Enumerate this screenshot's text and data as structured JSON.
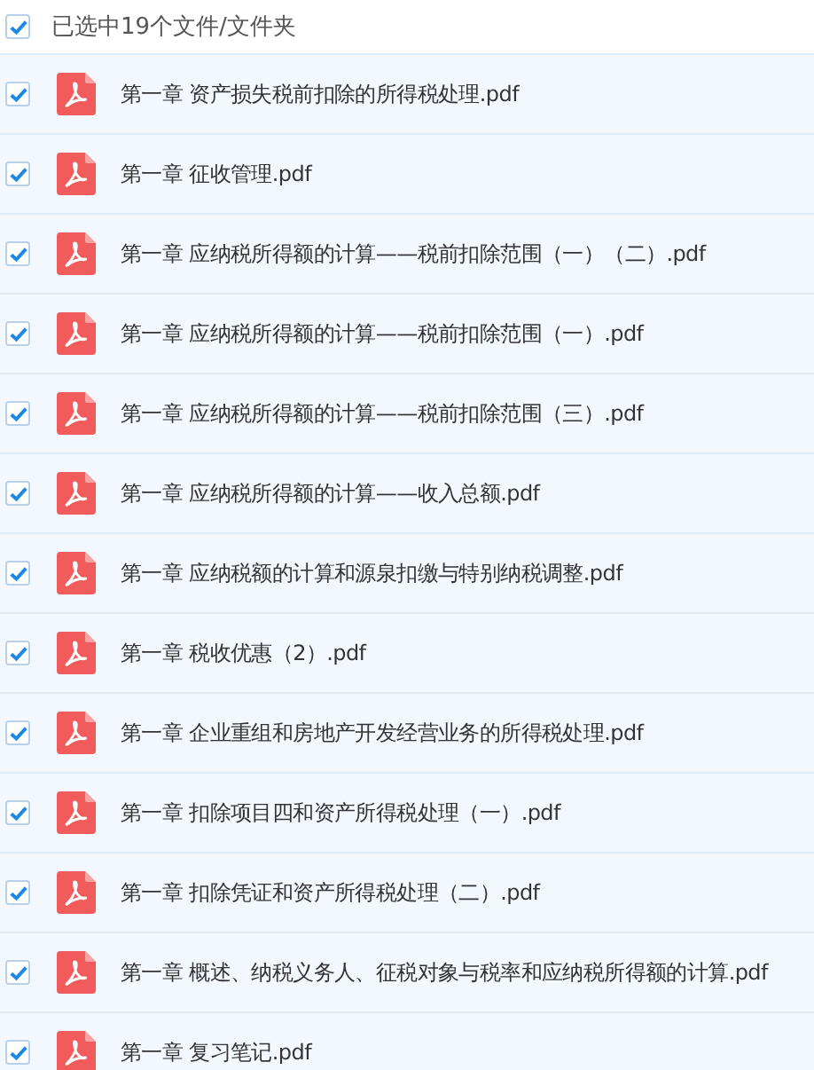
{
  "header": {
    "checked": true,
    "label": "已选中19个文件/文件夹"
  },
  "files": [
    {
      "checked": true,
      "name": "第一章 资产损失税前扣除的所得税处理.pdf"
    },
    {
      "checked": true,
      "name": "第一章 征收管理.pdf"
    },
    {
      "checked": true,
      "name": "第一章 应纳税所得额的计算——税前扣除范围（一）（二）.pdf"
    },
    {
      "checked": true,
      "name": "第一章 应纳税所得额的计算——税前扣除范围（一）.pdf"
    },
    {
      "checked": true,
      "name": "第一章 应纳税所得额的计算——税前扣除范围（三）.pdf"
    },
    {
      "checked": true,
      "name": "第一章 应纳税所得额的计算——收入总额.pdf"
    },
    {
      "checked": true,
      "name": "第一章 应纳税额的计算和源泉扣缴与特别纳税调整.pdf"
    },
    {
      "checked": true,
      "name": "第一章 税收优惠（2）.pdf"
    },
    {
      "checked": true,
      "name": "第一章 企业重组和房地产开发经营业务的所得税处理.pdf"
    },
    {
      "checked": true,
      "name": "第一章 扣除项目四和资产所得税处理（一）.pdf"
    },
    {
      "checked": true,
      "name": "第一章 扣除凭证和资产所得税处理（二）.pdf"
    },
    {
      "checked": true,
      "name": "第一章 概述、纳税义务人、征税对象与税率和应纳税所得额的计算.pdf"
    },
    {
      "checked": true,
      "name": "第一章 复习笔记.pdf"
    }
  ]
}
